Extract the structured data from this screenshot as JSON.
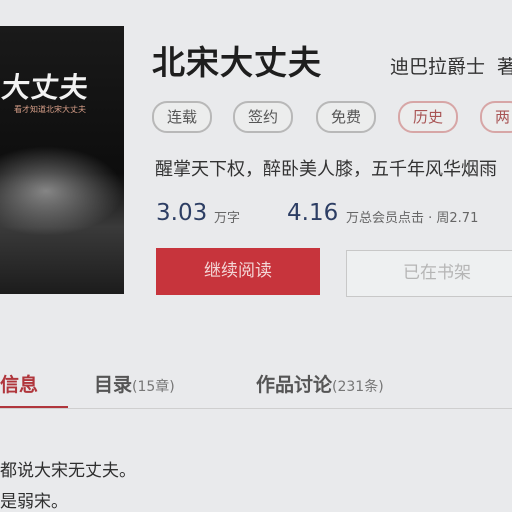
{
  "book": {
    "cover_title": "大丈夫",
    "cover_subtitle": "看才知道北宋大丈夫",
    "title": "北宋大丈夫",
    "author": "迪巴拉爵士",
    "author_suffix": "著"
  },
  "tags": [
    "连载",
    "签约",
    "免费",
    "历史",
    "两"
  ],
  "tagline": "醒掌天下权，醉卧美人膝，五千年风华烟雨",
  "stats": {
    "words_value": "3.03",
    "words_unit": "万字",
    "clicks_value": "4.16",
    "clicks_unit": "万总会员点击 · 周2.71"
  },
  "buttons": {
    "read": "继续阅读",
    "shelf": "已在书架"
  },
  "tabs": [
    {
      "label": "信息",
      "count": ""
    },
    {
      "label": "目录",
      "count": "(15章)"
    },
    {
      "label": "作品讨论",
      "count": "(231条)"
    }
  ],
  "intro_lines": [
    "都说大宋无丈夫。",
    "是弱宋。"
  ]
}
